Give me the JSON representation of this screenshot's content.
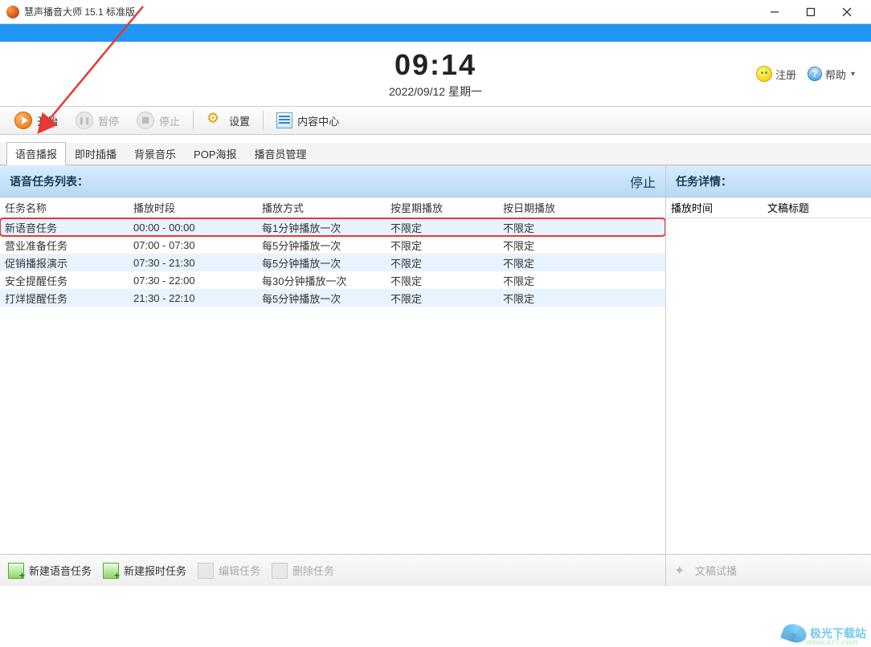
{
  "title": "慧声播音大师 15.1 标准版",
  "clock": {
    "time": "09:14",
    "date": "2022/09/12 星期一"
  },
  "headerButtons": {
    "register": "注册",
    "help": "帮助"
  },
  "toolbar": {
    "start": "开始",
    "pause": "暂停",
    "stop": "停止",
    "settings": "设置",
    "contentCenter": "内容中心"
  },
  "tabs": [
    "语音播报",
    "即时插播",
    "背景音乐",
    "POP海报",
    "播音员管理"
  ],
  "leftPanel": {
    "title": "语音任务列表：",
    "statusLabel": "停止",
    "columns": {
      "name": "任务名称",
      "time": "播放时段",
      "mode": "播放方式",
      "byWeek": "按星期播放",
      "byDate": "按日期播放"
    },
    "rows": [
      {
        "name": "新语音任务",
        "time": "00:00 - 00:00",
        "mode": "每1分钟播放一次",
        "week": "不限定",
        "date": "不限定",
        "selected": true
      },
      {
        "name": "营业准备任务",
        "time": "07:00 - 07:30",
        "mode": "每5分钟播放一次",
        "week": "不限定",
        "date": "不限定"
      },
      {
        "name": "促销播报演示",
        "time": "07:30 - 21:30",
        "mode": "每5分钟播放一次",
        "week": "不限定",
        "date": "不限定"
      },
      {
        "name": "安全提醒任务",
        "time": "07:30 - 22:00",
        "mode": "每30分钟播放一次",
        "week": "不限定",
        "date": "不限定"
      },
      {
        "name": "打烊提醒任务",
        "time": "21:30 - 22:10",
        "mode": "每5分钟播放一次",
        "week": "不限定",
        "date": "不限定"
      }
    ]
  },
  "rightPanel": {
    "title": "任务详情：",
    "columns": {
      "playTime": "播放时间",
      "docTitle": "文稿标题"
    }
  },
  "bottomBar": {
    "newVoiceTask": "新建语音任务",
    "newTimedTask": "新建报时任务",
    "editTask": "编辑任务",
    "deleteTask": "删除任务",
    "docPreview": "文稿试播"
  },
  "watermark": {
    "main": "极光下载站",
    "sub": "www.xz7.com"
  }
}
